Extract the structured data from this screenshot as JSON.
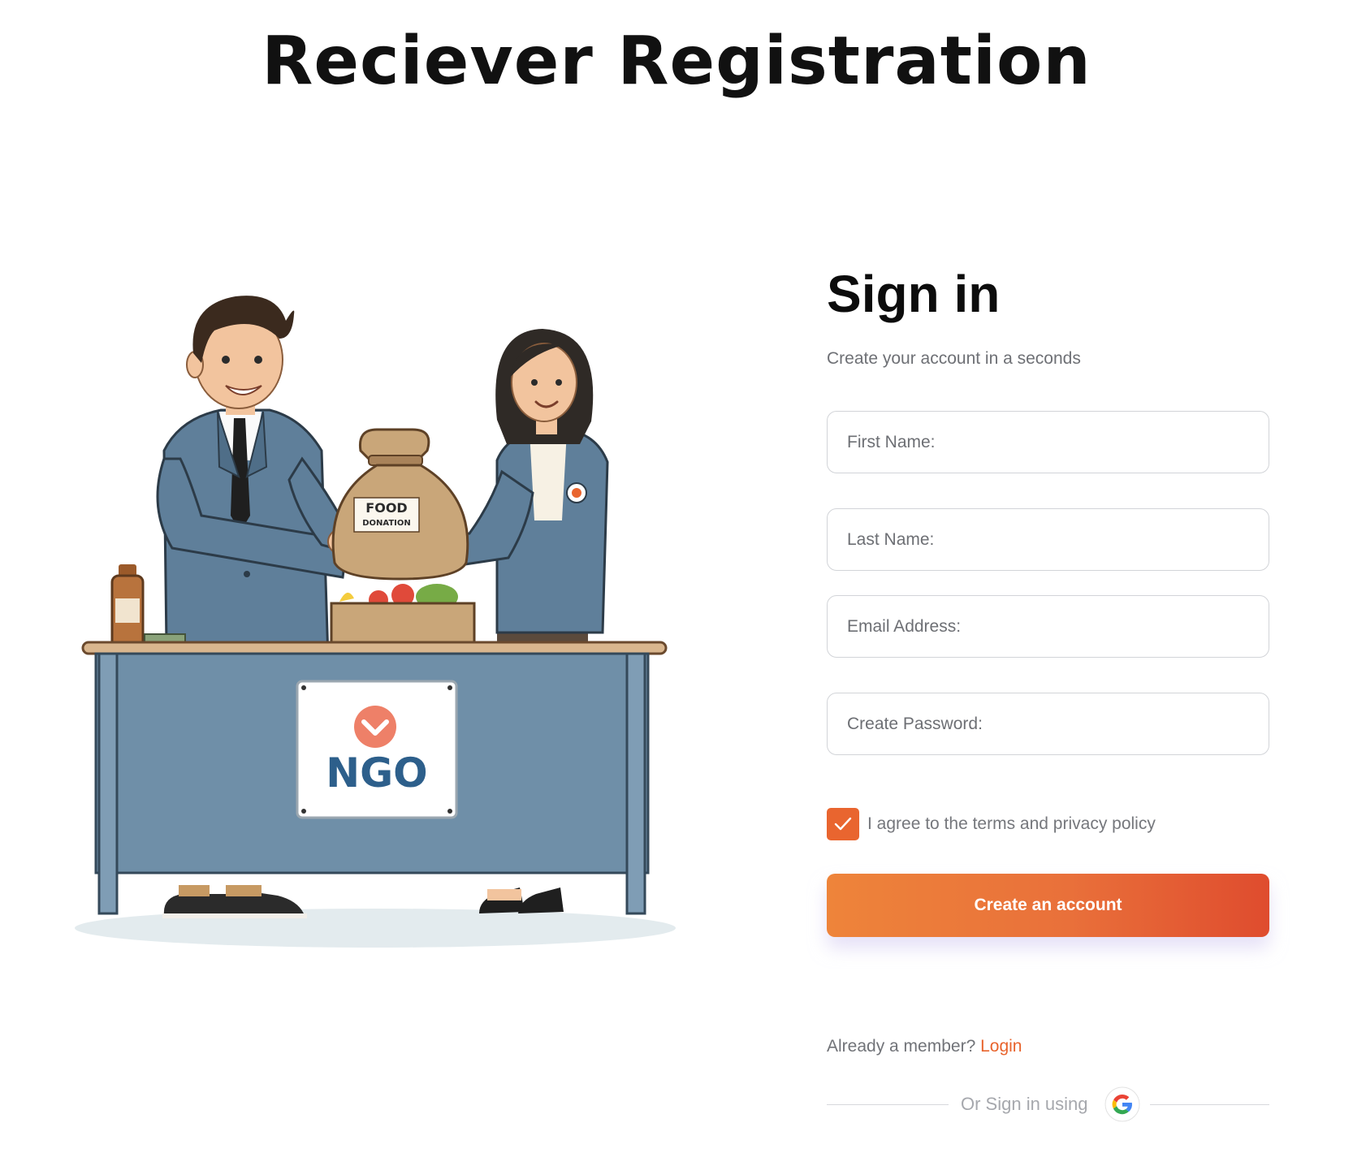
{
  "page": {
    "title": "Reciever Registration"
  },
  "illustration": {
    "bag_label_line1": "FOOD",
    "bag_label_line2": "DONATION",
    "sign_text": "NGO",
    "icon": "food-donation-illustration"
  },
  "form": {
    "heading": "Sign in",
    "subtitle": "Create your account in a seconds",
    "fields": {
      "first_name_placeholder": "First Name:",
      "last_name_placeholder": "Last Name:",
      "email_placeholder": "Email Address:",
      "password_placeholder": "Create Password:"
    },
    "terms": {
      "checked": true,
      "label": "I agree to the terms and privacy policy"
    },
    "submit_label": "Create an account",
    "member_prompt": "Already a member?",
    "login_label": "Login",
    "alt_signin_label": "Or Sign in using",
    "alt_signin_icon": "google-icon"
  },
  "colors": {
    "accent": "#e9652f",
    "button_gradient_start": "#ee843a",
    "button_gradient_end": "#df4c2e",
    "desk_blue": "#6f8fa8",
    "suit_blue": "#5f7f9a"
  }
}
